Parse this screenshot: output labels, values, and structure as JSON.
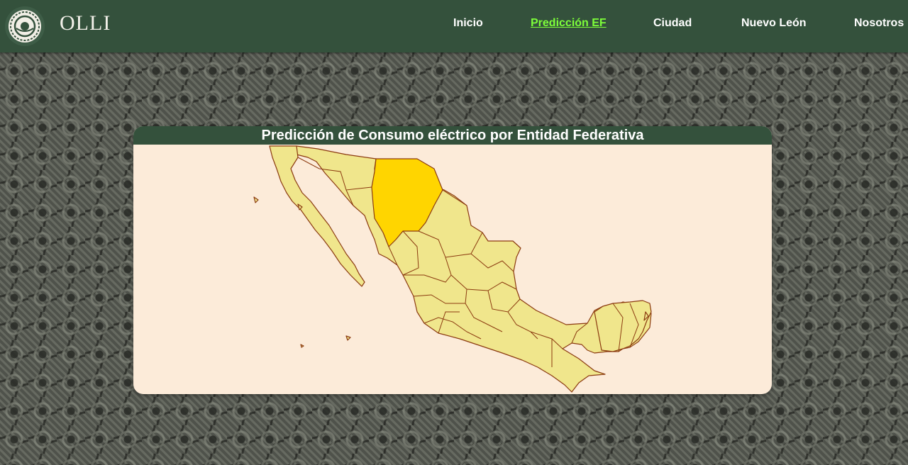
{
  "brand": {
    "name": "OLLI"
  },
  "nav": {
    "items": [
      {
        "label": "Inicio",
        "active": false
      },
      {
        "label": "Predicción EF",
        "active": true
      },
      {
        "label": "Ciudad",
        "active": false
      },
      {
        "label": "Nuevo León",
        "active": false
      },
      {
        "label": "Nosotros",
        "active": false
      }
    ]
  },
  "card": {
    "title": "Predicción de Consumo eléctrico por Entidad Federativa"
  },
  "map": {
    "highlighted_state": "chihuahua"
  },
  "colors": {
    "navbar": "#34513c",
    "active_link": "#7dff3a",
    "card_background": "#fcebd9",
    "state_fill": "#f0e68c",
    "state_highlight": "#ffd500",
    "state_border": "#8b3a10"
  }
}
